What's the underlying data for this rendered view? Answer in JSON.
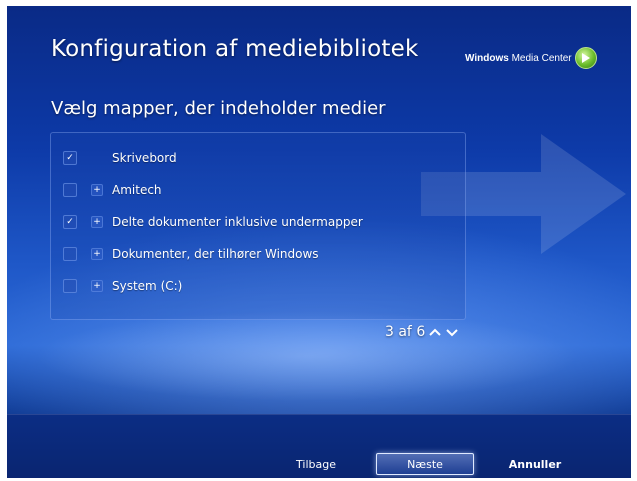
{
  "header": {
    "title": "Konfiguration af mediebibliotek",
    "brand_bold": "Windows",
    "brand_light": "Media Center",
    "brand_logo_icon": "media-center-logo-icon"
  },
  "subtitle": "Vælg mapper, der indeholder medier",
  "folders": [
    {
      "label": "Skrivebord",
      "checked": true,
      "expandable": false,
      "check_mark": "✓",
      "expand_mark": ""
    },
    {
      "label": "Amitech",
      "checked": false,
      "expandable": true,
      "check_mark": "",
      "expand_mark": "+"
    },
    {
      "label": "Delte dokumenter inklusive undermapper",
      "checked": true,
      "expandable": true,
      "check_mark": "✓",
      "expand_mark": "+"
    },
    {
      "label": "Dokumenter, der tilhører Windows",
      "checked": false,
      "expandable": true,
      "check_mark": "",
      "expand_mark": "+"
    },
    {
      "label": "System (C:)",
      "checked": false,
      "expandable": true,
      "check_mark": "",
      "expand_mark": "+"
    }
  ],
  "pager": {
    "text": "3 af 6"
  },
  "buttons": {
    "back": "Tilbage",
    "next": "Næste",
    "cancel": "Annuller"
  },
  "colors": {
    "background_blue": "#1f58c8",
    "footer_blue": "#0b2d84",
    "brand_green": "#6bbd2a"
  }
}
